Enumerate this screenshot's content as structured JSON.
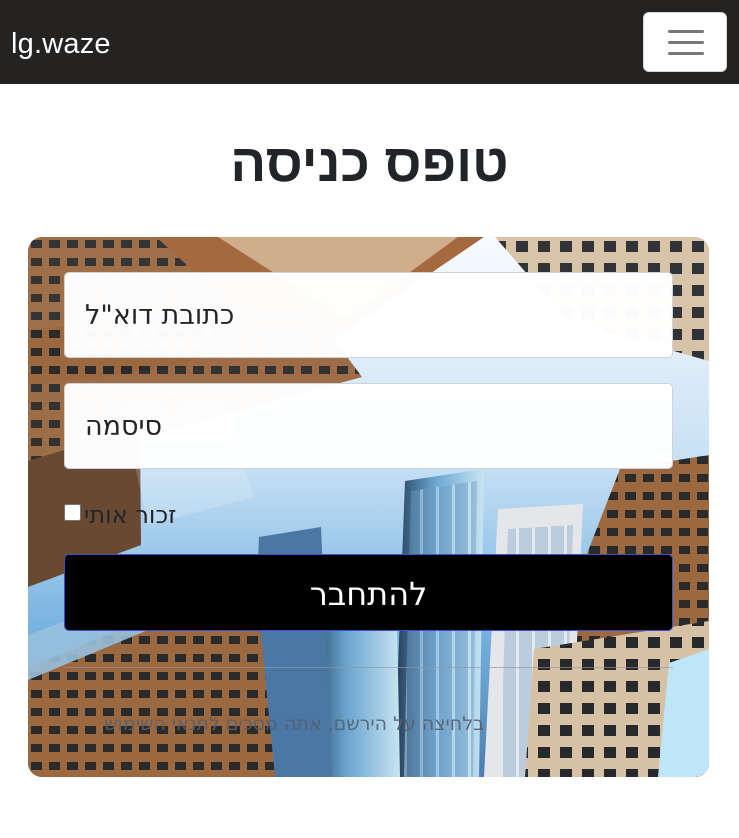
{
  "app": {
    "brand": "lg.waze"
  },
  "header": {
    "menu_icon": "hamburger-icon"
  },
  "page": {
    "title": "טופס כניסה"
  },
  "form": {
    "email_placeholder": "כתובת דוא\"ל",
    "email_value": "",
    "password_placeholder": "סיסמה",
    "password_value": "",
    "remember_label": "זכור אותי",
    "remember_checked": false,
    "submit_label": "להתחבר",
    "terms_text": "בלחיצה על הירשם, אתה מסכים לתנאי השימוש"
  },
  "colors": {
    "navbar": "#252321",
    "button": "#000000",
    "button_border": "#3a51d2",
    "title": "#212529"
  }
}
